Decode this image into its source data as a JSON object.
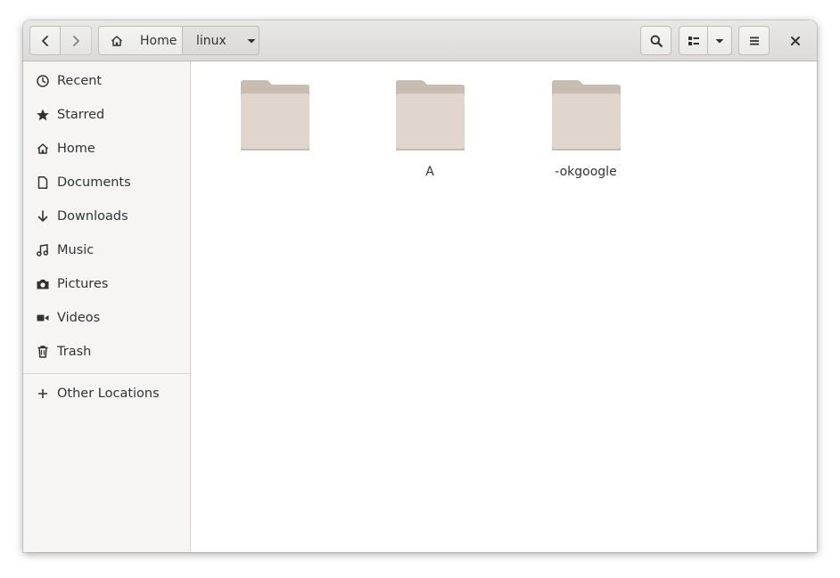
{
  "headerbar": {
    "back_icon": "go-previous-icon",
    "forward_icon": "go-next-icon",
    "path": [
      {
        "label": "Home",
        "icon": "home-icon"
      },
      {
        "label": "linux"
      }
    ],
    "path_menu_icon": "pan-down-icon",
    "search_icon": "search-icon",
    "view_icon": "view-list-icon",
    "view_menu_icon": "pan-down-icon",
    "menu_icon": "open-menu-icon",
    "close_icon": "close-icon"
  },
  "sidebar": {
    "items": [
      {
        "label": "Recent",
        "icon": "clock-icon"
      },
      {
        "label": "Starred",
        "icon": "star-icon"
      },
      {
        "label": "Home",
        "icon": "home-icon"
      },
      {
        "label": "Documents",
        "icon": "document-icon"
      },
      {
        "label": "Downloads",
        "icon": "download-icon"
      },
      {
        "label": "Music",
        "icon": "music-icon"
      },
      {
        "label": "Pictures",
        "icon": "camera-icon"
      },
      {
        "label": "Videos",
        "icon": "video-icon"
      },
      {
        "label": "Trash",
        "icon": "trash-icon"
      }
    ],
    "other_locations": {
      "label": "Other Locations",
      "icon": "plus-icon"
    }
  },
  "files": [
    {
      "name": "",
      "icon": "folder-icon"
    },
    {
      "name": "A",
      "icon": "folder-icon"
    },
    {
      "name": "-okgoogle",
      "icon": "folder-icon"
    }
  ],
  "colors": {
    "folder_back": "#c9bcb1",
    "folder_front": "#e0d6cd",
    "headerbar": "#dedcda",
    "sidebar": "#f6f5f4",
    "text": "#2e3436"
  }
}
